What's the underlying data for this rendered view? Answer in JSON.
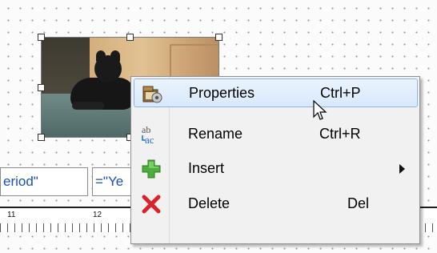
{
  "canvas": {
    "field_1_text": "eriod\"",
    "field_2_text": "=\"Ye",
    "ruler_labels": [
      "11",
      "12"
    ]
  },
  "context_menu": {
    "items": [
      {
        "label": "Properties",
        "shortcut": "Ctrl+P",
        "icon": "properties-icon"
      },
      {
        "label": "Rename",
        "shortcut": "Ctrl+R",
        "icon": "rename-icon"
      },
      {
        "label": "Insert",
        "shortcut": "",
        "icon": "insert-icon"
      },
      {
        "label": "Delete",
        "shortcut": "Del",
        "icon": "delete-icon"
      }
    ]
  },
  "colors": {
    "highlight": "#d9e9fb",
    "highlight_border": "#8ab4e6",
    "field_text": "#1c4fb8",
    "delete_red": "#d8232a",
    "insert_green": "#4caf3a"
  }
}
